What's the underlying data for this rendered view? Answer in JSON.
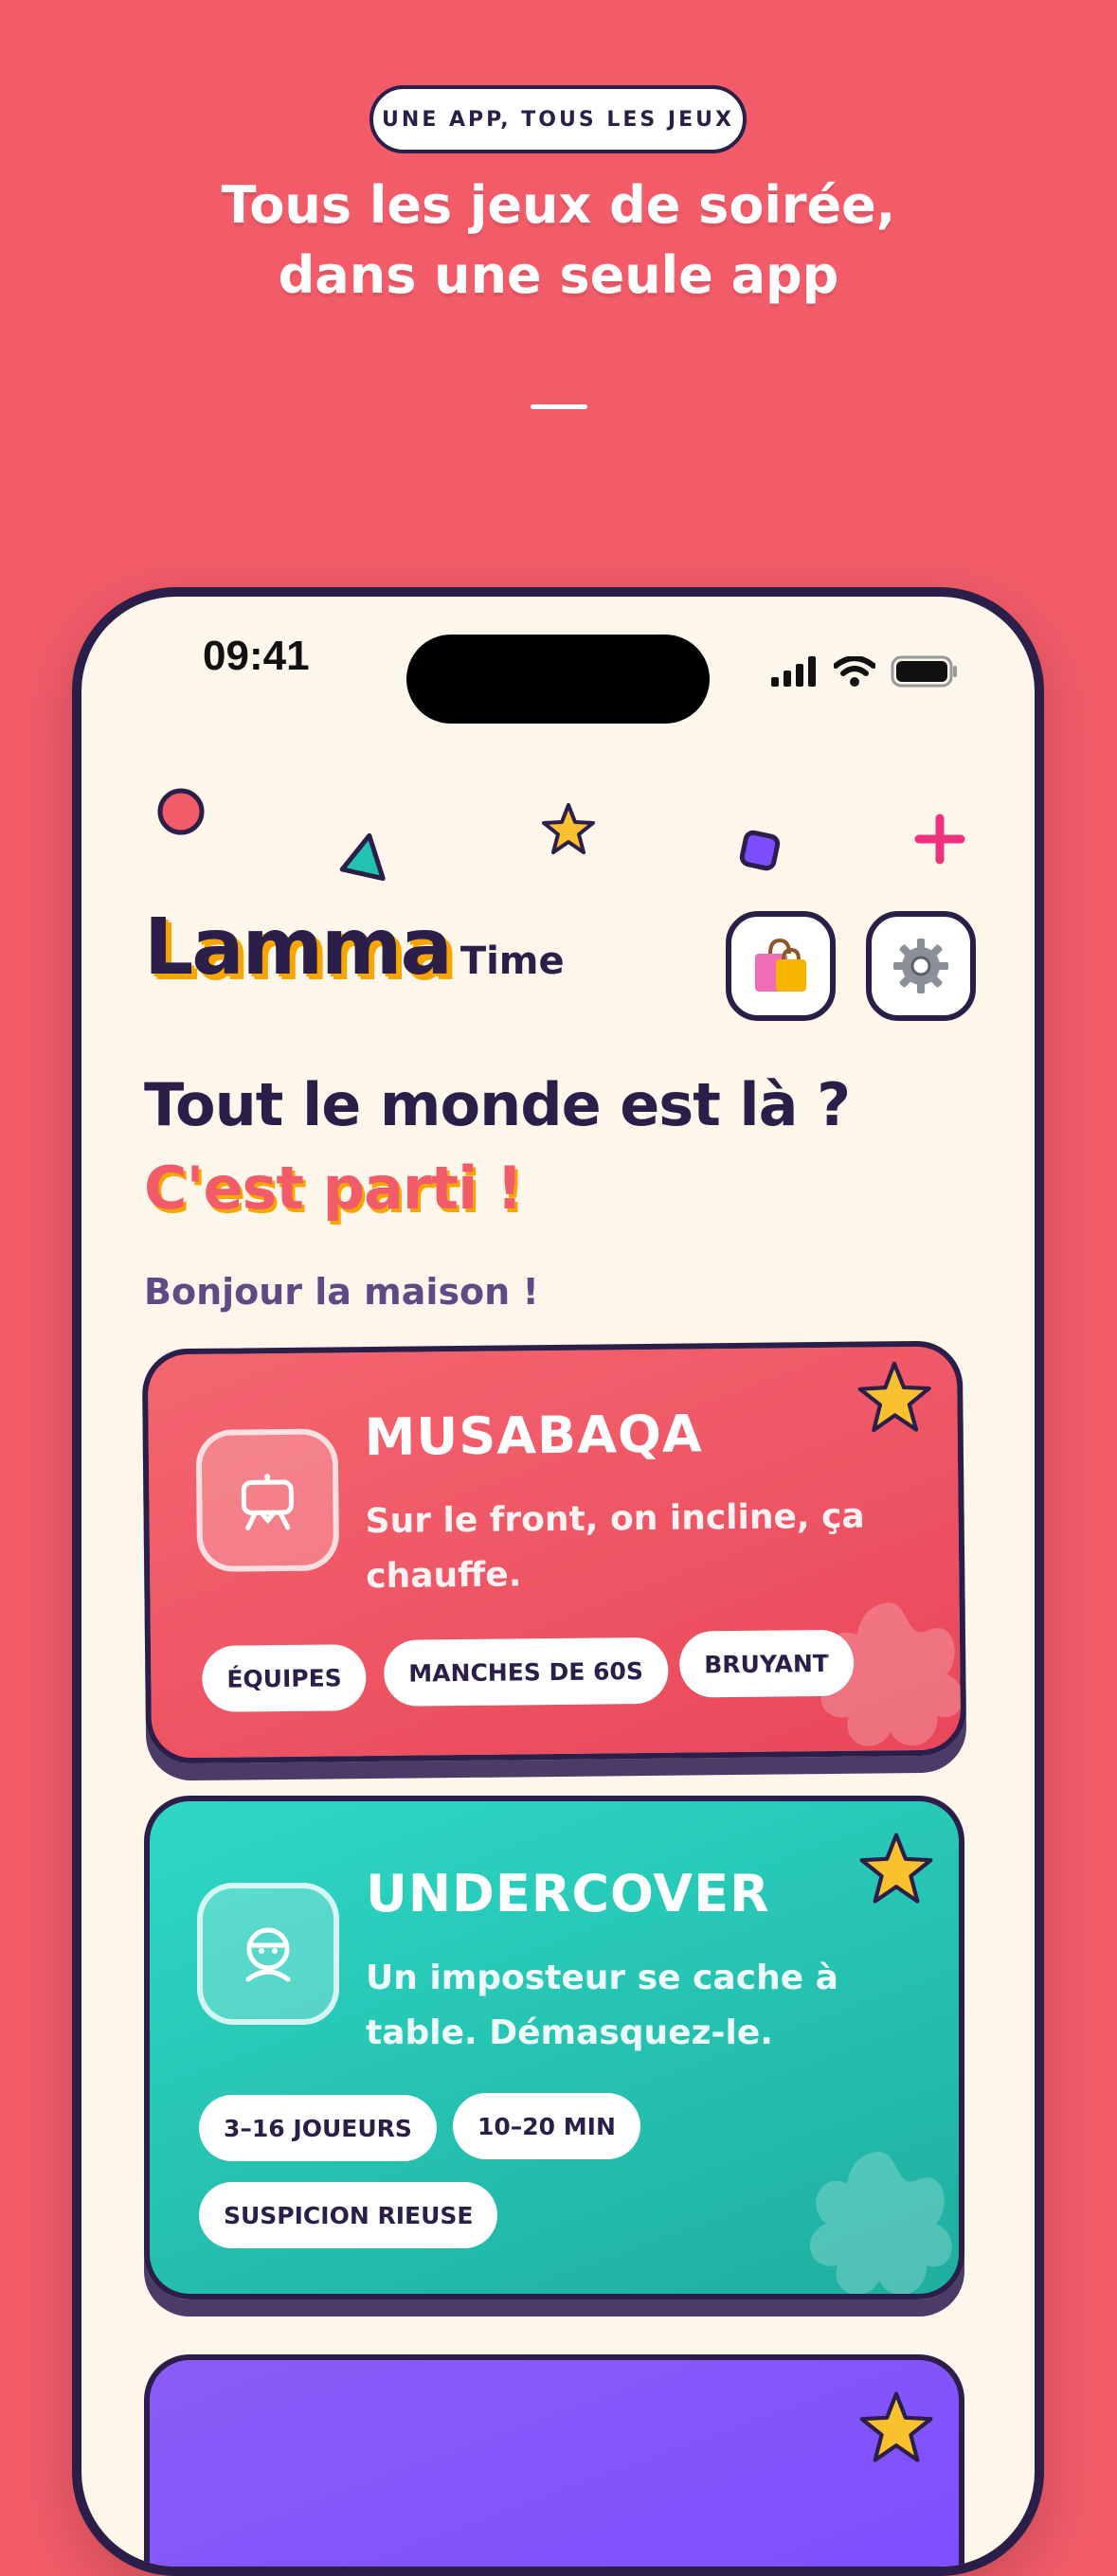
{
  "promo": {
    "badge": "UNE APP, TOUS LES JEUX",
    "headline_line1": "Tous les jeux de soirée,",
    "headline_line2": "dans une seule app"
  },
  "status_bar": {
    "time": "09:41"
  },
  "header": {
    "logo_main": "Lamma",
    "logo_sub": "Time",
    "shop_icon": "shopping-bags-icon",
    "settings_icon": "gear-icon"
  },
  "hero": {
    "title_line1": "Tout le monde est là ?",
    "title_line2": "C'est parti !",
    "greeting": "Bonjour la maison !"
  },
  "games": [
    {
      "title": "MUSABAQA",
      "description": "Sur le front, on incline, ça chauffe.",
      "tags": [
        "ÉQUIPES",
        "MANCHES DE 60S",
        "BRUYANT"
      ],
      "icon": "phone-on-stand-icon",
      "color": "#EF4E60"
    },
    {
      "title": "UNDERCOVER",
      "description": "Un imposteur se cache à table. Démasquez-le.",
      "tags": [
        "3–16 JOUEURS",
        "10–20 MIN",
        "SUSPICION RIEUSE"
      ],
      "icon": "masked-face-icon",
      "color": "#22C2B0"
    }
  ],
  "colors": {
    "background": "#F25C69",
    "ink": "#2B1F4A",
    "accent": "#F7A600",
    "star": "#FBC02D"
  }
}
